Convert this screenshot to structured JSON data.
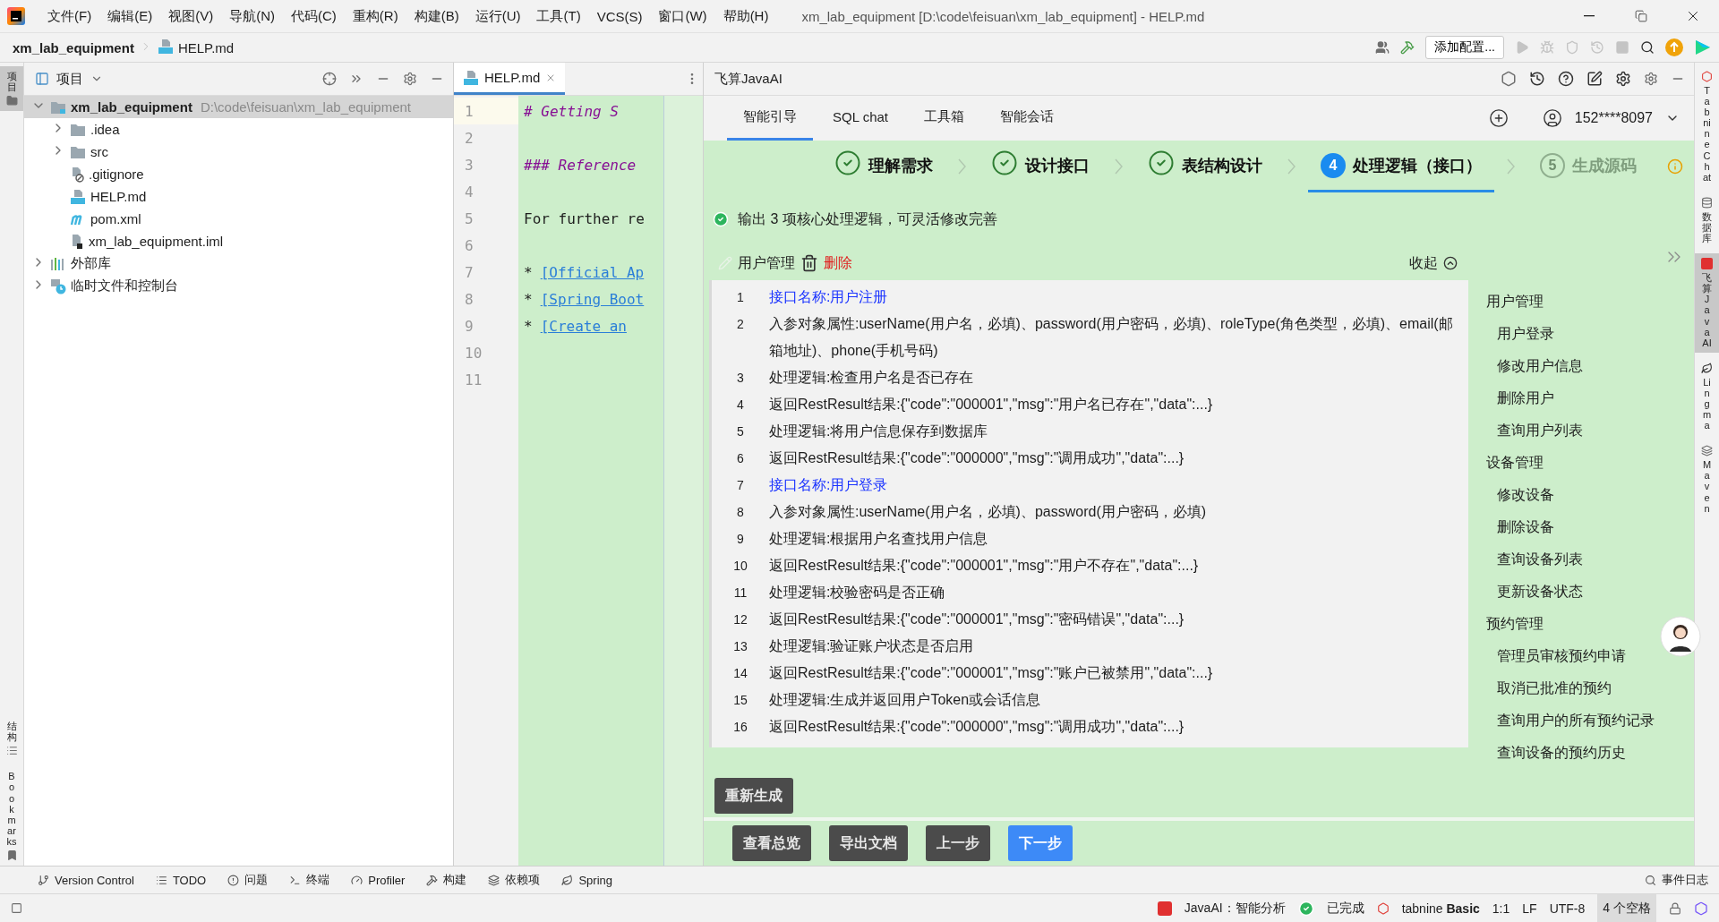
{
  "menu": [
    "文件(F)",
    "编辑(E)",
    "视图(V)",
    "导航(N)",
    "代码(C)",
    "重构(R)",
    "构建(B)",
    "运行(U)",
    "工具(T)",
    "VCS(S)",
    "窗口(W)",
    "帮助(H)"
  ],
  "window_title": "xm_lab_equipment [D:\\code\\feisuan\\xm_lab_equipment] - HELP.md",
  "breadcrumb": [
    "xm_lab_equipment",
    "HELP.md"
  ],
  "run_config": "添加配置...",
  "left_strip": [
    {
      "label": "项目",
      "selected": true
    },
    {
      "label": "结构",
      "selected": false
    },
    {
      "label": "Bookmarks",
      "selected": false
    }
  ],
  "project_panel": {
    "title": "项目",
    "tree": [
      {
        "label": "xm_lab_equipment",
        "path": "D:\\code\\feisuan\\xm_lab_equipment",
        "kind": "module",
        "selected": true,
        "expanded": true,
        "children": [
          {
            "label": ".idea",
            "kind": "folder",
            "selected": false,
            "expanded": false
          },
          {
            "label": "src",
            "kind": "folder",
            "selected": false,
            "expanded": false
          },
          {
            "label": ".gitignore",
            "kind": "ignore",
            "selected": false
          },
          {
            "label": "HELP.md",
            "kind": "markdown",
            "selected": false
          },
          {
            "label": "pom.xml",
            "kind": "maven",
            "selected": false
          },
          {
            "label": "xm_lab_equipment.iml",
            "kind": "iml",
            "selected": false
          }
        ]
      },
      {
        "label": "外部库",
        "kind": "library",
        "selected": false,
        "expanded": false
      },
      {
        "label": "临时文件和控制台",
        "kind": "scratches",
        "selected": false,
        "expanded": false
      }
    ]
  },
  "editor": {
    "tab": "HELP.md",
    "lines": [
      {
        "number": "1",
        "kind": "heading",
        "text": "# Getting S"
      },
      {
        "number": "2",
        "kind": "blank"
      },
      {
        "number": "3",
        "kind": "heading",
        "text": "### Reference"
      },
      {
        "number": "4",
        "kind": "blank"
      },
      {
        "number": "5",
        "kind": "text",
        "text": "For further re"
      },
      {
        "number": "6",
        "kind": "blank"
      },
      {
        "number": "7",
        "kind": "link",
        "bullet": "*",
        "text": "[Official Ap"
      },
      {
        "number": "8",
        "kind": "link",
        "bullet": "*",
        "text": "[Spring Boot"
      },
      {
        "number": "9",
        "kind": "link",
        "bullet": "*",
        "text": "[Create an "
      },
      {
        "number": "10",
        "kind": "blank"
      },
      {
        "number": "11",
        "kind": "blank"
      }
    ]
  },
  "ai_panel": {
    "title": "飞算JavaAI",
    "tabs": [
      {
        "label": "智能引导",
        "selected": true
      },
      {
        "label": "SQL chat",
        "selected": false
      },
      {
        "label": "工具箱",
        "selected": false
      },
      {
        "label": "智能会话",
        "selected": false
      }
    ],
    "account": "152****8097",
    "steps": [
      {
        "label": "理解需求",
        "kind": "done"
      },
      {
        "label": "设计接口",
        "kind": "done"
      },
      {
        "label": "表结构设计",
        "kind": "done"
      },
      {
        "number": "4",
        "label": "处理逻辑（接口）",
        "kind": "active"
      },
      {
        "number": "5",
        "label": "生成源码",
        "kind": "pending"
      }
    ],
    "notice": "输出 3 项核心处理逻辑，可灵活修改完善",
    "module": {
      "name": "用户管理",
      "delete": "删除",
      "collapse": "收起",
      "lines": [
        {
          "number": "1",
          "kind": "name",
          "text": "接口名称:用户注册"
        },
        {
          "number": "2",
          "kind": "text",
          "text": "入参对象属性:userName(用户名，必填)、password(用户密码，必填)、roleType(角色类型，必填)、email(邮箱地址)、phone(手机号码)"
        },
        {
          "number": "3",
          "kind": "text",
          "text": "处理逻辑:检查用户名是否已存在"
        },
        {
          "number": "4",
          "kind": "text",
          "text": "返回RestResult结果:{\"code\":\"000001\",\"msg\":\"用户名已存在\",\"data\":...}"
        },
        {
          "number": "5",
          "kind": "text",
          "text": "处理逻辑:将用户信息保存到数据库"
        },
        {
          "number": "6",
          "kind": "text",
          "text": "返回RestResult结果:{\"code\":\"000000\",\"msg\":\"调用成功\",\"data\":...}"
        },
        {
          "number": "7",
          "kind": "name",
          "text": "接口名称:用户登录"
        },
        {
          "number": "8",
          "kind": "text",
          "text": "入参对象属性:userName(用户名，必填)、password(用户密码，必填)"
        },
        {
          "number": "9",
          "kind": "text",
          "text": "处理逻辑:根据用户名查找用户信息"
        },
        {
          "number": "10",
          "kind": "text",
          "text": "返回RestResult结果:{\"code\":\"000001\",\"msg\":\"用户不存在\",\"data\":...}"
        },
        {
          "number": "11",
          "kind": "text",
          "text": "处理逻辑:校验密码是否正确"
        },
        {
          "number": "12",
          "kind": "text",
          "text": "返回RestResult结果:{\"code\":\"000001\",\"msg\":\"密码错误\",\"data\":...}"
        },
        {
          "number": "13",
          "kind": "text",
          "text": "处理逻辑:验证账户状态是否启用"
        },
        {
          "number": "14",
          "kind": "text",
          "text": "返回RestResult结果:{\"code\":\"000001\",\"msg\":\"账户已被禁用\",\"data\":...}"
        },
        {
          "number": "15",
          "kind": "text",
          "text": "处理逻辑:生成并返回用户Token或会话信息"
        },
        {
          "number": "16",
          "kind": "text",
          "text": "返回RestResult结果:{\"code\":\"000000\",\"msg\":\"调用成功\",\"data\":...}"
        }
      ]
    },
    "outline": [
      {
        "label": "用户管理",
        "children": [
          "用户登录",
          "修改用户信息",
          "删除用户",
          "查询用户列表"
        ]
      },
      {
        "label": "设备管理",
        "children": [
          "修改设备",
          "删除设备",
          "查询设备列表",
          "更新设备状态"
        ]
      },
      {
        "label": "预约管理",
        "children": [
          "管理员审核预约申请",
          "取消已批准的预约",
          "查询用户的所有预约记录",
          "查询设备的预约历史"
        ]
      }
    ],
    "regenerate": "重新生成",
    "buttons": [
      {
        "label": "查看总览",
        "primary": false
      },
      {
        "label": "导出文档",
        "primary": false
      },
      {
        "label": "上一步",
        "primary": false
      },
      {
        "label": "下一步",
        "primary": true
      }
    ]
  },
  "right_strip": [
    {
      "label": "Tabnine Chat",
      "selected": false
    },
    {
      "label": "数据库",
      "selected": false
    },
    {
      "label": "飞算JavaAI",
      "selected": true
    },
    {
      "label": "Lingma",
      "selected": false
    },
    {
      "label": "Maven",
      "selected": false
    }
  ],
  "tool_windows": [
    "Version Control",
    "TODO",
    "问题",
    "终端",
    "Profiler",
    "构建",
    "依赖项",
    "Spring"
  ],
  "event_log": "事件日志",
  "status": {
    "javaai": "JavaAI：智能分析",
    "done": "已完成",
    "tabnine": "tabnine **Basic**",
    "position": "1:1",
    "line_sep": "LF",
    "encoding": "UTF-8",
    "indent": "4 个空格"
  }
}
